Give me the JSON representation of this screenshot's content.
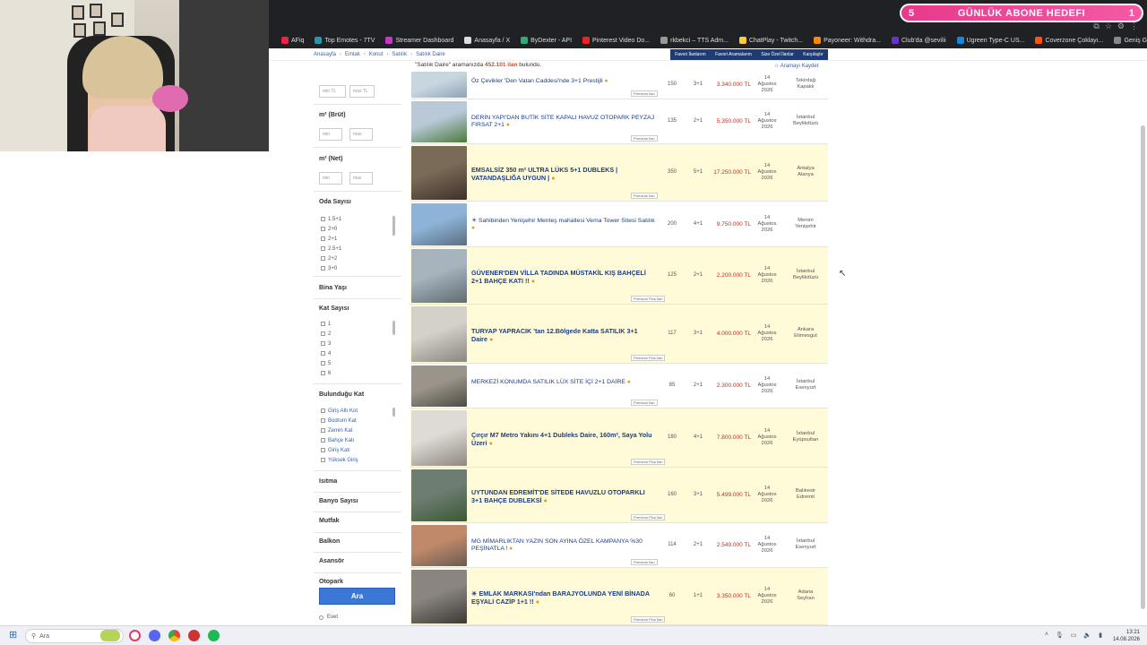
{
  "goal": {
    "left_count": "5",
    "title": "GÜNLÜK ABONE HEDEFI",
    "right_count": "1"
  },
  "bookmarks": [
    {
      "label": "AFiq",
      "color": "#e24"
    },
    {
      "label": "Top Emotes - 7TV",
      "color": "#29a"
    },
    {
      "label": "Streamer Dashboard",
      "color": "#c3c"
    },
    {
      "label": "Anasayfa / X",
      "color": "#ddd"
    },
    {
      "label": "ByDexter - API",
      "color": "#3a7"
    },
    {
      "label": "Pinterest Video Do...",
      "color": "#e22"
    },
    {
      "label": "rkbekci – TTS Adm...",
      "color": "#999"
    },
    {
      "label": "ChatPlay - Twitch...",
      "color": "#fc3"
    },
    {
      "label": "Payoneer: Withdra...",
      "color": "#f80"
    },
    {
      "label": "Club'da @sevilii",
      "color": "#63c"
    },
    {
      "label": "Ugreen Type-C US...",
      "color": "#18d"
    },
    {
      "label": "Coverzone Çoklayı...",
      "color": "#f50"
    },
    {
      "label": "Geniş Gözenekler...",
      "color": "#888"
    }
  ],
  "breadcrumb": [
    "Anasayfa",
    "Emlak",
    "Konut",
    "Satılık",
    "Satılık Daire"
  ],
  "fav_bar": [
    "Favori İlanlarım",
    "Favori Aramalarım",
    "Size Özel İlanlar",
    "Karşılaştır"
  ],
  "search_result": {
    "query": "\"Satılık Daire\"",
    "middle": "aramanızda",
    "count": "452.101 ilan",
    "suffix": "bulundu."
  },
  "save_search": "☆ Aramayı Kaydet",
  "sidebar": {
    "price_min": "min TL",
    "price_max": "max TL",
    "m2_brut": "m² (Brüt)",
    "m2_net": "m² (Net)",
    "min": "min",
    "max": "max",
    "oda_title": "Oda Sayısı",
    "oda": [
      "1.5+1",
      "2+0",
      "2+1",
      "2.5+1",
      "2+2",
      "3+0"
    ],
    "bina_yasi": "Bina Yaşı",
    "kat_title": "Kat Sayısı",
    "kat": [
      "1",
      "2",
      "3",
      "4",
      "5",
      "6"
    ],
    "bulundugu_title": "Bulunduğu Kat",
    "bulundugu": [
      "Giriş Altı Kot",
      "Bodrum Kat",
      "Zemin Kat",
      "Bahçe Katı",
      "Giriş Katı",
      "Yüksek Giriş"
    ],
    "isitma": "Isıtma",
    "banyo": "Banyo Sayısı",
    "mutfak": "Mutfak",
    "balkon": "Balkon",
    "asansor": "Asansör",
    "otopark": "Otopark",
    "search_button": "Ara",
    "evet": "Evet"
  },
  "listings": [
    {
      "title": "Öz Çevikler 'Den Vatan Caddesi'nde 3+1 Prestijli",
      "bold": false,
      "highlight": false,
      "premium": "Premium İlan",
      "m2": "150",
      "rooms": "3+1",
      "price": "3.340.000 TL",
      "date": [
        "14",
        "Ağustos",
        "2026"
      ],
      "loc": [
        "Tekirdağ",
        "Kapaklı"
      ],
      "img": [
        "#c8d6e0",
        "#8fa3b4"
      ]
    },
    {
      "title": "DERİN YAPI'DAN BUTİK SİTE KAPALI HAVUZ OTOPARK PEYZAJ FIRSAT 2+1",
      "bold": false,
      "highlight": false,
      "premium": "Premium İlan",
      "m2": "135",
      "rooms": "2+1",
      "price": "5.350.000 TL",
      "date": [
        "14",
        "Ağustos",
        "2026"
      ],
      "loc": [
        "İstanbul",
        "Beylikdüzü"
      ],
      "img": [
        "#b9c9d8",
        "#4c7a3a"
      ]
    },
    {
      "title": "EMSALSİZ 350 m² ULTRA LÜKS 5+1 DUBLEKS | VATANDAŞLIĞA UYGUN |",
      "bold": true,
      "highlight": true,
      "premium": "Premium İlan",
      "m2": "350",
      "rooms": "5+1",
      "price": "17.250.000 TL",
      "date": [
        "14",
        "Ağustos",
        "2026"
      ],
      "loc": [
        "Antalya",
        "Alanya"
      ],
      "img": [
        "#7a6a58",
        "#3d3128"
      ]
    },
    {
      "title": "☀ Sahibinden Yenişehir Menteş mahallesi Vema Tower Sitesi Satılık",
      "bold": false,
      "highlight": false,
      "premium": "",
      "m2": "200",
      "rooms": "4+1",
      "price": "9.750.000 TL",
      "date": [
        "14",
        "Ağustos",
        "2026"
      ],
      "loc": [
        "Mersin",
        "Yenişehir"
      ],
      "img": [
        "#8db4d8",
        "#5c6e80"
      ]
    },
    {
      "title": "GÜVENER'DEN VİLLA TADINDA MÜSTAKİL KIŞ BAHÇELİ 2+1 BAHÇE KATI !!",
      "bold": true,
      "highlight": true,
      "premium": "Premium Plus İlan",
      "m2": "125",
      "rooms": "2+1",
      "price": "2.200.000 TL",
      "date": [
        "14",
        "Ağustos",
        "2026"
      ],
      "loc": [
        "İstanbul",
        "Beylikdüzü"
      ],
      "img": [
        "#a7b3bd",
        "#5f6c72"
      ]
    },
    {
      "title": "TURYAP YAPRACIK 'tan 12.Bölgede Katta SATILIK 3+1 Daire",
      "bold": true,
      "highlight": true,
      "premium": "Premium Plus İlan",
      "m2": "117",
      "rooms": "3+1",
      "price": "4.000.000 TL",
      "date": [
        "14",
        "Ağustos",
        "2026"
      ],
      "loc": [
        "Ankara",
        "Etimesgut"
      ],
      "img": [
        "#d4d0ca",
        "#8b8680"
      ]
    },
    {
      "title": "MERKEZİ KONUMDA SATILIK LÜX SİTE İÇİ 2+1 DAİRE",
      "bold": false,
      "highlight": false,
      "premium": "Premium İlan",
      "m2": "85",
      "rooms": "2+1",
      "price": "2.300.000 TL",
      "date": [
        "14",
        "Ağustos",
        "2026"
      ],
      "loc": [
        "İstanbul",
        "Esenyurt"
      ],
      "img": [
        "#9a948a",
        "#4f4a44"
      ]
    },
    {
      "title": "Çırçır M7 Metro Yakını 4+1 Dubleks Daire, 160m², Saya Yolu Üzeri",
      "bold": true,
      "highlight": true,
      "premium": "Premium Plus İlan",
      "m2": "180",
      "rooms": "4+1",
      "price": "7.800.000 TL",
      "date": [
        "14",
        "Ağustos",
        "2026"
      ],
      "loc": [
        "İstanbul",
        "Eyüpsultan"
      ],
      "img": [
        "#dedbd6",
        "#8d8880"
      ]
    },
    {
      "title": "UYTUNDAN EDREMİT'DE SİTEDE HAVUZLU OTOPARKLI 3+1 BAHÇE DUBLEKSİ",
      "bold": true,
      "highlight": true,
      "premium": "Premium Plus İlan",
      "m2": "160",
      "rooms": "3+1",
      "price": "5.499.000 TL",
      "date": [
        "14",
        "Ağustos",
        "2026"
      ],
      "loc": [
        "Balıkesir",
        "Edremit"
      ],
      "img": [
        "#6e7d72",
        "#3a5a34"
      ]
    },
    {
      "title": "MG MİMARLIKTAN YAZIN SON AYINA ÖZEL KAMPANYA %30 PEŞİNATLA !",
      "bold": false,
      "highlight": false,
      "premium": "Premium İlan",
      "m2": "114",
      "rooms": "2+1",
      "price": "2.549.000 TL",
      "date": [
        "14",
        "Ağustos",
        "2026"
      ],
      "loc": [
        "İstanbul",
        "Esenyurt"
      ],
      "img": [
        "#c08a6a",
        "#6c5a52"
      ]
    },
    {
      "title": "☀ EMLAK MARKASI'ndan BARAJYOLUNDA YENİ BİNADA EŞYALI CAZİP 1+1 !!",
      "bold": true,
      "highlight": true,
      "premium": "Premium Plus İlan",
      "m2": "60",
      "rooms": "1+1",
      "price": "3.350.000 TL",
      "date": [
        "14",
        "Ağustos",
        "2026"
      ],
      "loc": [
        "Adana",
        "Seyhan"
      ],
      "img": [
        "#8a8580",
        "#3c3835"
      ]
    }
  ],
  "taskbar": {
    "search_placeholder": "Ara",
    "time": "13:21",
    "date": "14.08.2026"
  }
}
